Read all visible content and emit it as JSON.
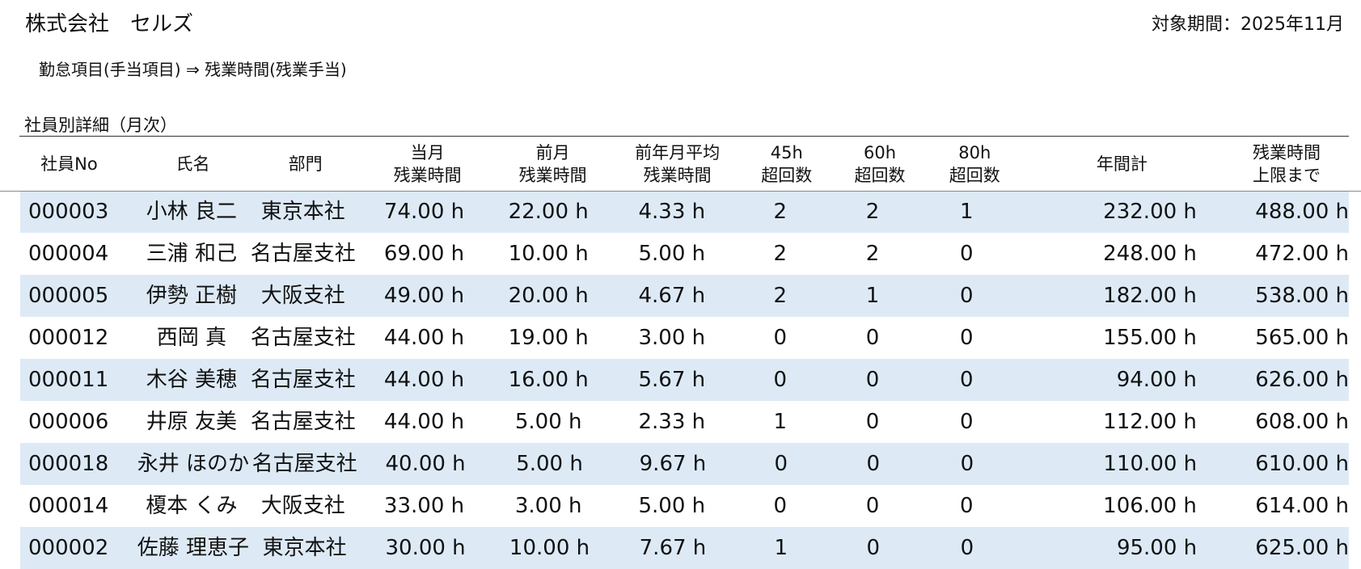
{
  "header": {
    "company": "株式会社　セルズ",
    "period": "対象期間：2025年11月",
    "breadcrumb": "勤怠項目(手当項目) ⇒ 残業時間(残業手当)",
    "section_title": "社員別詳細（月次）"
  },
  "table": {
    "columns": [
      [
        "社員No"
      ],
      [
        "氏名"
      ],
      [
        "部門"
      ],
      [
        "当月",
        "残業時間"
      ],
      [
        "前月",
        "残業時間"
      ],
      [
        "前年月平均",
        "残業時間"
      ],
      [
        "45h",
        "超回数"
      ],
      [
        "60h",
        "超回数"
      ],
      [
        "80h",
        "超回数"
      ],
      [
        "年間計"
      ],
      [
        "残業時間",
        "上限まで"
      ]
    ],
    "rows": [
      [
        "000003",
        "小林 良二",
        "東京本社",
        "74.00 h",
        "22.00 h",
        "4.33 h",
        "2",
        "2",
        "1",
        "232.00 h",
        "488.00 h"
      ],
      [
        "000004",
        "三浦 和己",
        "名古屋支社",
        "69.00 h",
        "10.00 h",
        "5.00 h",
        "2",
        "2",
        "0",
        "248.00 h",
        "472.00 h"
      ],
      [
        "000005",
        "伊勢 正樹",
        "大阪支社",
        "49.00 h",
        "20.00 h",
        "4.67 h",
        "2",
        "1",
        "0",
        "182.00 h",
        "538.00 h"
      ],
      [
        "000012",
        "西岡 真",
        "名古屋支社",
        "44.00 h",
        "19.00 h",
        "3.00 h",
        "0",
        "0",
        "0",
        "155.00 h",
        "565.00 h"
      ],
      [
        "000011",
        "木谷 美穂",
        "名古屋支社",
        "44.00 h",
        "16.00 h",
        "5.67 h",
        "0",
        "0",
        "0",
        "94.00 h",
        "626.00 h"
      ],
      [
        "000006",
        "井原 友美",
        "名古屋支社",
        "44.00 h",
        "5.00 h",
        "2.33 h",
        "1",
        "0",
        "0",
        "112.00 h",
        "608.00 h"
      ],
      [
        "000018",
        "永井 ほのか",
        "名古屋支社",
        "40.00 h",
        "5.00 h",
        "9.67 h",
        "0",
        "0",
        "0",
        "110.00 h",
        "610.00 h"
      ],
      [
        "000014",
        "榎本 くみ",
        "大阪支社",
        "33.00 h",
        "3.00 h",
        "5.00 h",
        "0",
        "0",
        "0",
        "106.00 h",
        "614.00 h"
      ],
      [
        "000002",
        "佐藤 理恵子",
        "東京本社",
        "30.00 h",
        "10.00 h",
        "7.67 h",
        "1",
        "0",
        "0",
        "95.00 h",
        "625.00 h"
      ]
    ],
    "stripe_color": "#ddeaf6"
  }
}
